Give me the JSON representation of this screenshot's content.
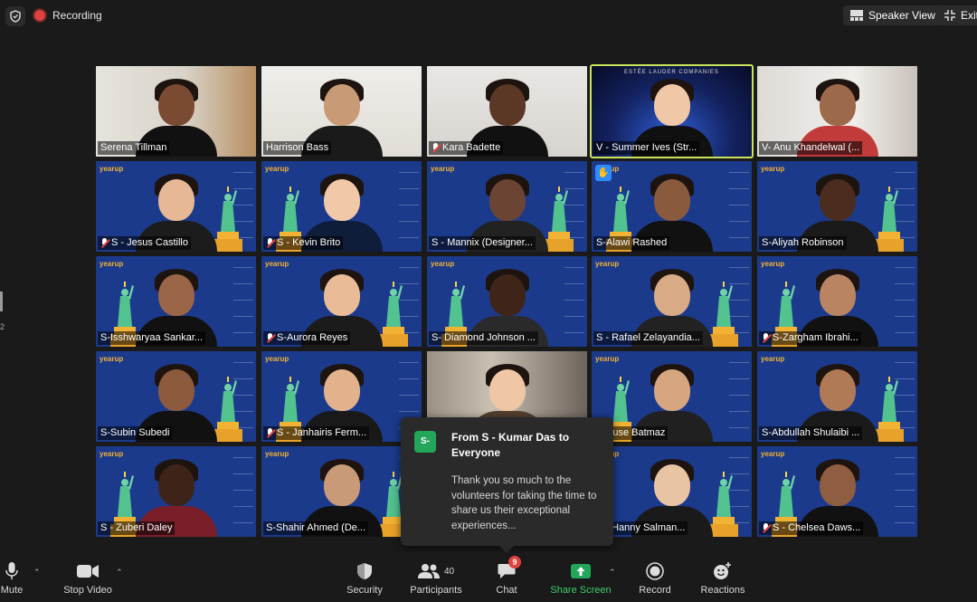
{
  "topbar": {
    "recording_label": "Recording",
    "speaker_view_label": "Speaker View",
    "exit_label": "Exit",
    "side_number": "2"
  },
  "colors": {
    "background": "#1a1a1a",
    "tile_blue": "#1c3a8c",
    "active_speaker": "#c9e35a",
    "recording_red": "#e0413e",
    "share_green": "#23a55a",
    "yearup_gold": "#f2b233"
  },
  "tiles": [
    {
      "name": "Serena Tillman",
      "muted": false,
      "kind": "camera"
    },
    {
      "name": "Harrison Bass",
      "muted": false,
      "kind": "camera"
    },
    {
      "name": "Kara Badette",
      "muted": true,
      "kind": "camera"
    },
    {
      "name": "V - Summer Ives (Str...",
      "muted": false,
      "kind": "estee",
      "active": true,
      "banner": "ESTĒE LAUDER COMPANIES"
    },
    {
      "name": "V- Anu Khandelwal (...",
      "muted": false,
      "kind": "camera"
    },
    {
      "name": "S - Jesus Castillo",
      "muted": true,
      "kind": "yearup"
    },
    {
      "name": "S - Kevin Brito",
      "muted": true,
      "kind": "yearup"
    },
    {
      "name": "S - Mannix (Designer...",
      "muted": false,
      "kind": "yearup"
    },
    {
      "name": "S-Alawi Rashed",
      "muted": false,
      "kind": "yearup",
      "hand": true
    },
    {
      "name": "S-Aliyah Robinson",
      "muted": false,
      "kind": "yearup"
    },
    {
      "name": "S-Isshwaryaa Sankar...",
      "muted": false,
      "kind": "yearup"
    },
    {
      "name": "S-Aurora Reyes",
      "muted": true,
      "kind": "yearup"
    },
    {
      "name": "S- Diamond Johnson ...",
      "muted": false,
      "kind": "yearup"
    },
    {
      "name": "S - Rafael Zelayandia...",
      "muted": false,
      "kind": "yearup"
    },
    {
      "name": "S-Zargham Ibrahi...",
      "muted": true,
      "kind": "yearup"
    },
    {
      "name": "S-Subin Subedi",
      "muted": false,
      "kind": "yearup"
    },
    {
      "name": "S - Janhairis Ferm...",
      "muted": true,
      "kind": "yearup"
    },
    {
      "name": "",
      "muted": false,
      "kind": "camera"
    },
    {
      "name": "S-Buse Batmaz",
      "muted": false,
      "kind": "yearup"
    },
    {
      "name": "S-Abdullah Shulaibi ...",
      "muted": false,
      "kind": "yearup"
    },
    {
      "name": "S - Zuberi Daley",
      "muted": false,
      "kind": "yearup"
    },
    {
      "name": "S-Shahir Ahmed (De...",
      "muted": false,
      "kind": "yearup"
    },
    {
      "name": "",
      "muted": false,
      "kind": "yearup"
    },
    {
      "name": "S - Hanny Salman...",
      "muted": false,
      "kind": "yearup"
    },
    {
      "name": "S - Chelsea Daws...",
      "muted": true,
      "kind": "yearup"
    }
  ],
  "yearup_logo": "yearup",
  "chat_popup": {
    "avatar": "S-",
    "title": "From S - Kumar Das to Everyone",
    "message": "Thank you so much to the volunteers for taking the time to share us their exceptional experiences..."
  },
  "toolbar": {
    "mute_label": "Mute",
    "stop_video_label": "Stop Video",
    "security_label": "Security",
    "participants_label": "Participants",
    "participants_count": "40",
    "chat_label": "Chat",
    "chat_badge": "9",
    "share_label": "Share Screen",
    "record_label": "Record",
    "reactions_label": "Reactions"
  }
}
